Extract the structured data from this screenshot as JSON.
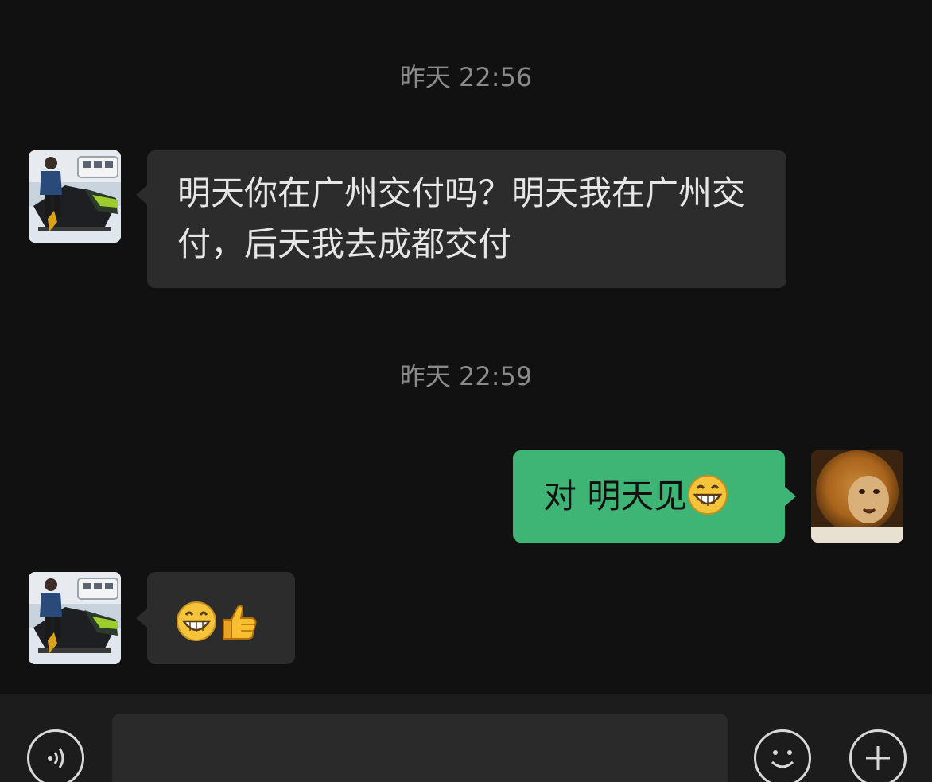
{
  "messages": [
    {
      "type": "time",
      "text": "昨天 22:56"
    },
    {
      "type": "in",
      "text": "明天你在广州交付吗？明天我在广州交付，后天我去成都交付"
    },
    {
      "type": "time",
      "text": "昨天 22:59"
    },
    {
      "type": "out",
      "text": "对 明天见",
      "emoji": "grin-emoji"
    },
    {
      "type": "in",
      "emojis": [
        "grin-emoji",
        "thumbs-up-emoji"
      ]
    }
  ],
  "input_bar": {
    "left_icon": "voice-icon",
    "right_icons": [
      "emoji-icon",
      "plus-icon"
    ]
  },
  "colors": {
    "background": "#111111",
    "incoming_bubble": "#2c2c2c",
    "outgoing_bubble": "#3eb575",
    "timestamp": "#8a8a8a"
  }
}
